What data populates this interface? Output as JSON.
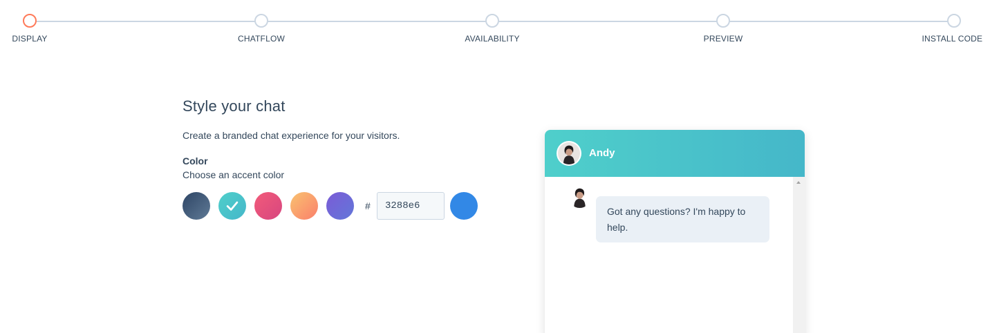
{
  "stepper": {
    "active_index": 0,
    "steps": [
      {
        "label": "DISPLAY"
      },
      {
        "label": "CHATFLOW"
      },
      {
        "label": "AVAILABILITY"
      },
      {
        "label": "PREVIEW"
      },
      {
        "label": "INSTALL CODE"
      }
    ],
    "active_color": "#ff7a59",
    "inactive_color": "#cbd6e2"
  },
  "main": {
    "title": "Style your chat",
    "subtitle": "Create a branded chat experience for your visitors.",
    "color_heading": "Color",
    "color_help": "Choose an accent color",
    "swatches": [
      {
        "name": "slate",
        "color_from": "#2e4565",
        "color_to": "#5f7a96",
        "selected": false
      },
      {
        "name": "teal",
        "color_from": "#4fcfcb",
        "color_to": "#45b7c9",
        "selected": true
      },
      {
        "name": "pink",
        "color_from": "#f25b7a",
        "color_to": "#d7467f",
        "selected": false
      },
      {
        "name": "orange",
        "color_from": "#f9c270",
        "color_to": "#fa7f6b",
        "selected": false
      },
      {
        "name": "purple",
        "color_from": "#7b5bd6",
        "color_to": "#6277d9",
        "selected": false
      }
    ],
    "hash_symbol": "#",
    "hex_value": "3288e6",
    "custom_color_preview": "#3288e6"
  },
  "chat_preview": {
    "agent_name": "Andy",
    "header_gradient_from": "#4fcfcb",
    "header_gradient_to": "#45b7c9",
    "message": "Got any questions? I'm happy to help."
  }
}
